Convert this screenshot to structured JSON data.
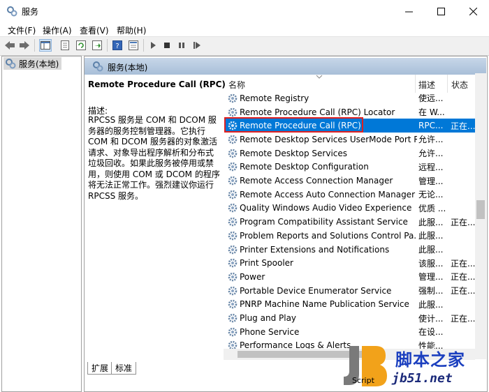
{
  "window": {
    "title": "服务",
    "minimize": "—",
    "maximize": "☐",
    "close": "✕"
  },
  "menu": [
    "文件(F)",
    "操作(A)",
    "查看(V)",
    "帮助(H)"
  ],
  "tree": {
    "item": "服务(本地)"
  },
  "pane": {
    "header": "服务(本地)"
  },
  "detail": {
    "title": "Remote Procedure Call (RPC)",
    "desc_label": "描述:",
    "desc": "RPCSS 服务是 COM 和 DCOM 服务器的服务控制管理器。它执行 COM 和 DCOM 服务器的对象激活请求、对象导出程序解析和分布式垃圾回收。如果此服务被停用或禁用，则使用 COM 或 DCOM 的程序将无法正常工作。强烈建议你运行 RPCSS 服务。"
  },
  "columns": {
    "name": "名称",
    "desc": "描述",
    "status": "状态"
  },
  "services": [
    {
      "name": "Remote Registry",
      "desc": "使远...",
      "status": ""
    },
    {
      "name": "Remote Procedure Call (RPC) Locator",
      "desc": "在 W...",
      "status": ""
    },
    {
      "name": "Remote Procedure Call (RPC)",
      "desc": "RPC...",
      "status": "正在...",
      "selected": true
    },
    {
      "name": "Remote Desktop Services UserMode Port R...",
      "desc": "允许...",
      "status": ""
    },
    {
      "name": "Remote Desktop Services",
      "desc": "允许...",
      "status": ""
    },
    {
      "name": "Remote Desktop Configuration",
      "desc": "远程...",
      "status": ""
    },
    {
      "name": "Remote Access Connection Manager",
      "desc": "管理...",
      "status": ""
    },
    {
      "name": "Remote Access Auto Connection Manager",
      "desc": "无论...",
      "status": ""
    },
    {
      "name": "Quality Windows Audio Video Experience",
      "desc": "优质 ...",
      "status": ""
    },
    {
      "name": "Program Compatibility Assistant Service",
      "desc": "此服...",
      "status": "正在..."
    },
    {
      "name": "Problem Reports and Solutions Control Pa...",
      "desc": "此服...",
      "status": ""
    },
    {
      "name": "Printer Extensions and Notifications",
      "desc": "此服...",
      "status": ""
    },
    {
      "name": "Print Spooler",
      "desc": "该服...",
      "status": "正在..."
    },
    {
      "name": "Power",
      "desc": "管理...",
      "status": "正在..."
    },
    {
      "name": "Portable Device Enumerator Service",
      "desc": "强制...",
      "status": "正在..."
    },
    {
      "name": "PNRP Machine Name Publication Service",
      "desc": "此服...",
      "status": ""
    },
    {
      "name": "Plug and Play",
      "desc": "使计...",
      "status": "正在..."
    },
    {
      "name": "Phone Service",
      "desc": "在设...",
      "status": ""
    },
    {
      "name": "Performance Logs & Alerts",
      "desc": "性能...",
      "status": ""
    }
  ],
  "tabs": [
    "扩展",
    "标准"
  ],
  "watermark": {
    "cn": "脚本之家",
    "url": "jb51.net",
    "script": "Script"
  },
  "colors": {
    "selection": "#0078d7",
    "highlight_box": "#e02020",
    "watermark_blue": "#1b3fbf"
  }
}
